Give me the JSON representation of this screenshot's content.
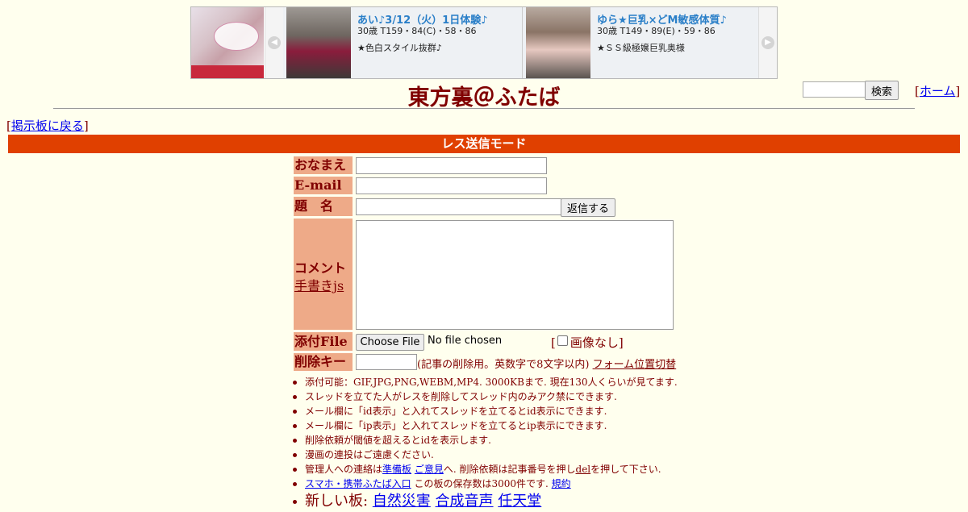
{
  "ad": {
    "left_card": {
      "name": "あい♪3/12（火）1日体験♪",
      "spec": "30歳 T159・84(C)・58・86",
      "catch": "★色白スタイル抜群♪"
    },
    "right_card": {
      "name": "ゆら★巨乳×どM敏感体質♪",
      "spec": "30歳 T149・89(E)・59・86",
      "catch": "★ＳＳ級極嬢巨乳奥様"
    },
    "prev_glyph": "◀",
    "next_glyph": "▶"
  },
  "header": {
    "title": "東方裏＠ふたば",
    "search_button": "検索",
    "home_link": "ホーム",
    "bracket_open": "[",
    "bracket_close": "]"
  },
  "nav": {
    "back_link": "掲示板に戻る"
  },
  "mode_bar": "レス送信モード",
  "form": {
    "name_label": "おなまえ",
    "email_label": "E-mail",
    "subject_label": "題　名",
    "submit_button": "返信する",
    "comment_label": "コメント",
    "handwriting_link": "手書きjs",
    "file_label": "添付File",
    "choose_file_button": "Choose File",
    "no_file_text": "No file chosen",
    "no_image_label": "画像なし",
    "delete_key_label": "削除キー",
    "delete_key_note": "(記事の削除用。英数字で8文字以内)",
    "form_position_link": "フォーム位置切替"
  },
  "notes": {
    "line1": "添付可能：GIF,JPG,PNG,WEBM,MP4. 3000KBまで. 現在130人くらいが見てます.",
    "line2": "スレッドを立てた人がレスを削除してスレッド内のみアク禁にできます.",
    "line3": "メール欄に「id表示」と入れてスレッドを立てるとid表示にできます.",
    "line4": "メール欄に「ip表示」と入れてスレッドを立てるとip表示にできます.",
    "line5": "削除依頼が閾値を超えるとidを表示します.",
    "line6": "漫画の連投はご遠慮ください.",
    "line7": {
      "prefix": "管理人への連絡は",
      "link1": "準備板",
      "link2": "ご意見",
      "middle": "へ. 削除依頼は記事番号を押し",
      "link3": "del",
      "suffix": "を押して下さい."
    },
    "line8": {
      "link1": "スマホ・携帯ふたば入口",
      "middle": "この板の保存数は3000件です.",
      "link2": "規約"
    },
    "line9": {
      "prefix": "新しい板:",
      "link1": "自然災害",
      "link2": "合成音声",
      "link3": "任天堂"
    }
  },
  "colors": {
    "page_background": "#ffffee",
    "text": "#800000",
    "accent_bar": "#e04000",
    "label_background": "#eeaa88",
    "link": "#0000ee"
  }
}
